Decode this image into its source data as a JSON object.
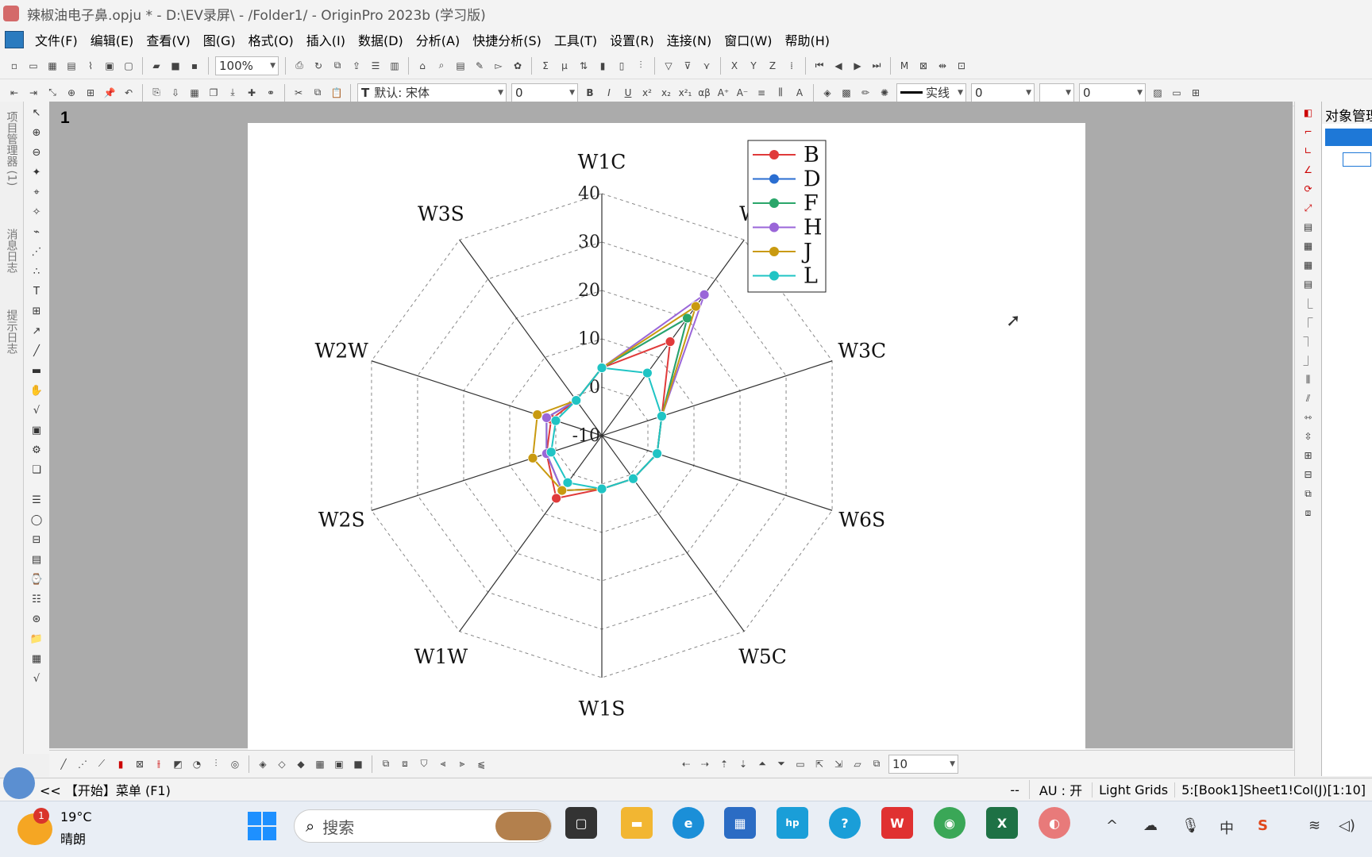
{
  "window": {
    "title": "辣椒油电子鼻.opju * - D:\\EV录屏\\ - /Folder1/ - OriginPro 2023b (学习版)"
  },
  "menu": [
    "文件(F)",
    "编辑(E)",
    "查看(V)",
    "图(G)",
    "格式(O)",
    "插入(I)",
    "数据(D)",
    "分析(A)",
    "快捷分析(S)",
    "工具(T)",
    "设置(R)",
    "连接(N)",
    "窗口(W)",
    "帮助(H)"
  ],
  "toolbar": {
    "zoom": "100%",
    "font": "默认: 宋体",
    "font_size": "0",
    "line_style": "实线",
    "line_width": "0",
    "fill_value": "0",
    "bottom_size": "10"
  },
  "left_tabs": [
    "项目管理器 (1)",
    "消息日志",
    "提示日志"
  ],
  "sheet_number": "1",
  "object_panel": {
    "title": "对象管理"
  },
  "status": {
    "start_menu": "<< 【开始】菜单 (F1)",
    "dashes": "--",
    "au": "AU : 开",
    "grids": "Light Grids",
    "cell": "5:[Book1]Sheet1!Col(J)[1:10]"
  },
  "taskbar": {
    "weather_badge": "1",
    "temperature": "19°C",
    "condition": "晴朗",
    "search_placeholder": "搜索",
    "lang": "中"
  },
  "chart_data": {
    "type": "radar",
    "axes": [
      "W1C",
      "W5S",
      "W3C",
      "W6S",
      "W5C",
      "W1S",
      "W1W",
      "W2S",
      "W2W",
      "W3S"
    ],
    "radial_ticks": [
      -10,
      0,
      10,
      20,
      30,
      40
    ],
    "rlim": [
      -10,
      40
    ],
    "grid": true,
    "legend_position": "top-right",
    "series": [
      {
        "name": "B",
        "color": "#e03a3a",
        "values": [
          4,
          14,
          3,
          2,
          1,
          1,
          6,
          2,
          1,
          -1
        ]
      },
      {
        "name": "D",
        "color": "#2a6ed1",
        "values": [
          4,
          20,
          3,
          2,
          1,
          1,
          4,
          2,
          2,
          -1
        ]
      },
      {
        "name": "F",
        "color": "#2aa66a",
        "values": [
          4,
          20,
          3,
          2,
          1,
          1,
          4,
          2,
          2,
          -1
        ]
      },
      {
        "name": "H",
        "color": "#9a66d8",
        "values": [
          4,
          26,
          3,
          2,
          1,
          1,
          4,
          2,
          2,
          -1
        ]
      },
      {
        "name": "J",
        "color": "#c99a10",
        "values": [
          4,
          23,
          3,
          2,
          1,
          1,
          4,
          5,
          4,
          -1
        ]
      },
      {
        "name": "L",
        "color": "#1fc4c4",
        "values": [
          4,
          6,
          3,
          2,
          1,
          1,
          2,
          1,
          0,
          -1
        ]
      }
    ]
  }
}
